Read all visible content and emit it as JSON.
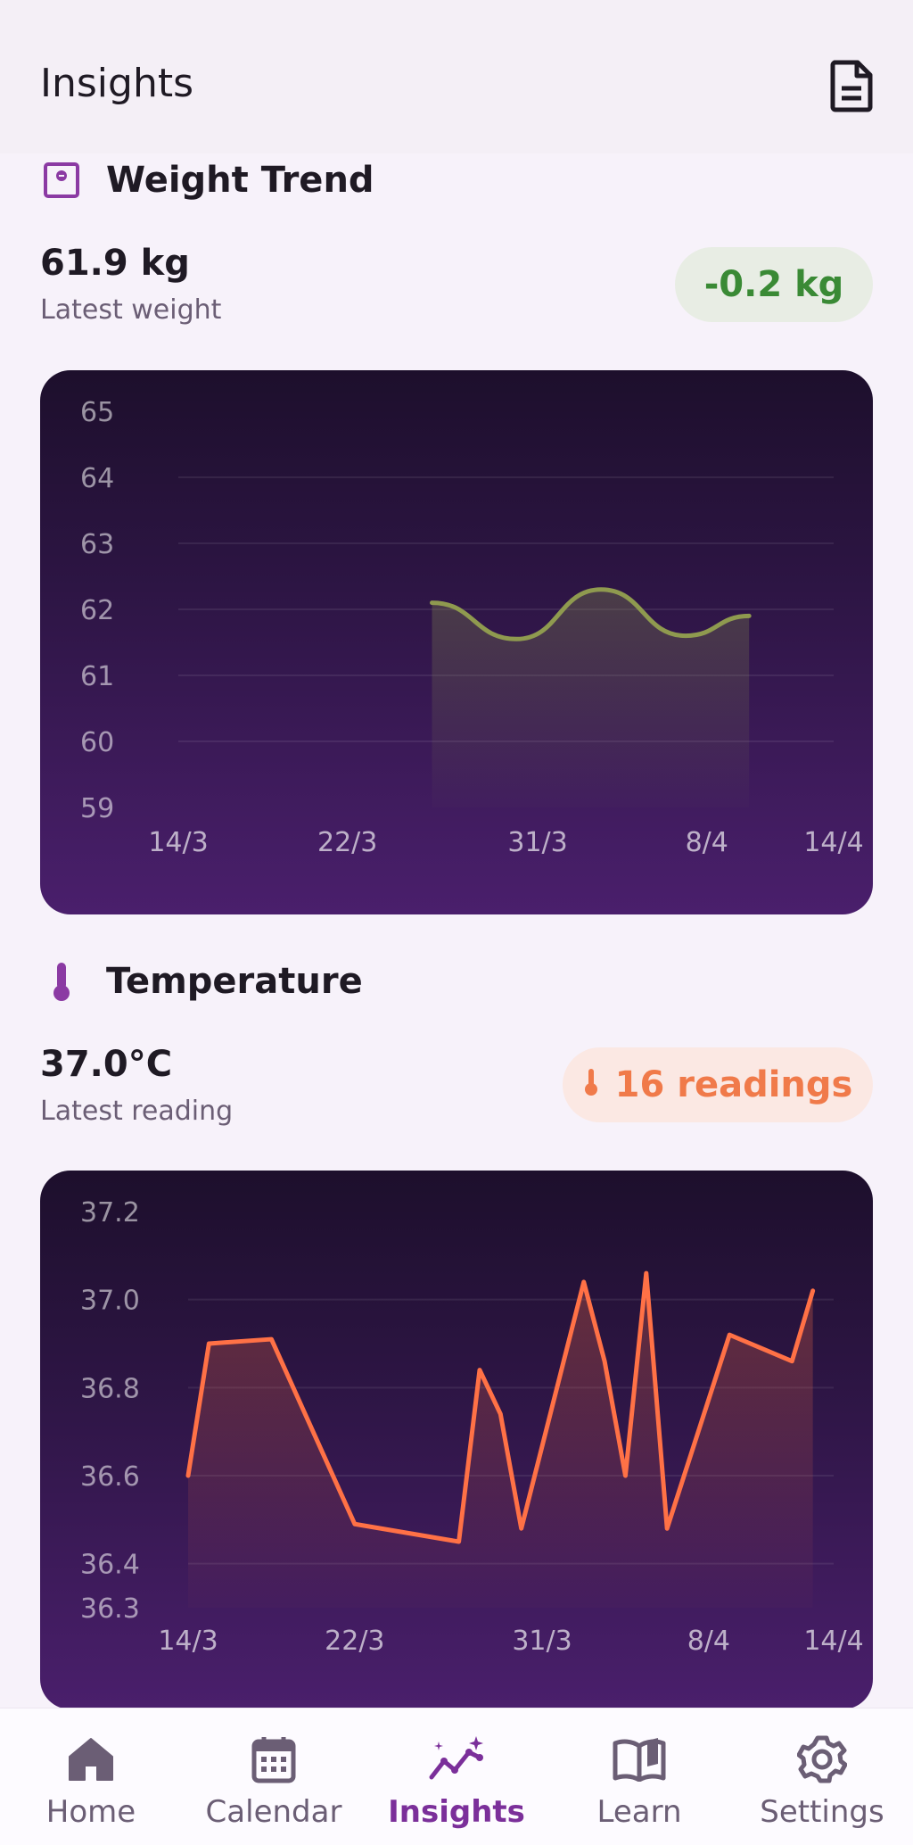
{
  "appbar": {
    "title": "Insights",
    "action_icon": "document-icon"
  },
  "weight": {
    "section_title": "Weight Trend",
    "icon": "scale-icon",
    "value": "61.9 kg",
    "sub": "Latest weight",
    "badge": "-0.2 kg",
    "badge_color": "#3a8a35"
  },
  "temperature": {
    "section_title": "Temperature",
    "icon": "thermometer-icon",
    "value": "37.0°C",
    "sub": "Latest reading",
    "badge": "16 readings",
    "badge_color": "#f07a4a"
  },
  "chart_data": [
    {
      "type": "area",
      "y_ticks": [
        "65",
        "64",
        "63",
        "62",
        "61",
        "60",
        "59"
      ],
      "x_ticks": [
        "14/3",
        "22/3",
        "31/3",
        "8/4",
        "14/4"
      ],
      "ylim": [
        59,
        65
      ],
      "x_tick_days": [
        0,
        8,
        17,
        25,
        31
      ],
      "x": [
        12,
        16,
        20,
        24,
        27
      ],
      "values": [
        62.1,
        61.55,
        62.3,
        61.6,
        61.9
      ],
      "line_color": "#8f9a4f",
      "grid": true
    },
    {
      "type": "area",
      "y_ticks": [
        "37.2",
        "37.0",
        "36.8",
        "36.6",
        "36.4",
        "36.3"
      ],
      "x_ticks": [
        "14/3",
        "22/3",
        "31/3",
        "8/4",
        "14/4"
      ],
      "ylim": [
        36.3,
        37.2
      ],
      "x_tick_days": [
        0,
        8,
        17,
        25,
        31
      ],
      "x": [
        0,
        1,
        4,
        8,
        13,
        14,
        15,
        16,
        19,
        20,
        21,
        22,
        23,
        26,
        29,
        30
      ],
      "values": [
        36.6,
        36.9,
        36.91,
        36.49,
        36.45,
        36.84,
        36.74,
        36.48,
        37.04,
        36.86,
        36.6,
        37.06,
        36.48,
        36.92,
        36.86,
        37.02
      ],
      "line_color": "#ff7146",
      "grid": true
    }
  ],
  "nav": [
    {
      "label": "Home",
      "icon": "home-icon",
      "active": false
    },
    {
      "label": "Calendar",
      "icon": "calendar-icon",
      "active": false
    },
    {
      "label": "Insights",
      "icon": "insights-icon",
      "active": true
    },
    {
      "label": "Learn",
      "icon": "book-icon",
      "active": false
    },
    {
      "label": "Settings",
      "icon": "gear-icon",
      "active": false
    }
  ]
}
